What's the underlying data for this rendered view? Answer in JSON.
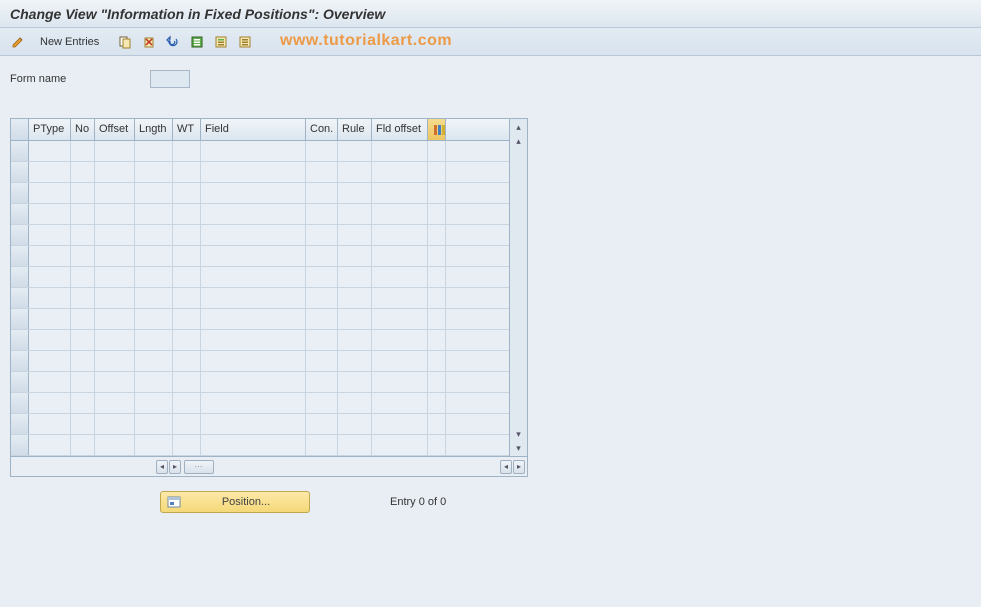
{
  "title": "Change View \"Information in Fixed Positions\": Overview",
  "toolbar": {
    "new_entries_label": "New Entries"
  },
  "watermark": "www.tutorialkart.com",
  "form": {
    "name_label": "Form name",
    "name_value": ""
  },
  "table": {
    "headers": {
      "ptype": "PType",
      "no": "No",
      "offset": "Offset",
      "lngth": "Lngth",
      "wt": "WT",
      "field": "Field",
      "con": "Con.",
      "rule": "Rule",
      "fld_offset": "Fld offset"
    },
    "rows": 15
  },
  "footer": {
    "position_label": "Position...",
    "entry_status": "Entry 0 of 0"
  }
}
